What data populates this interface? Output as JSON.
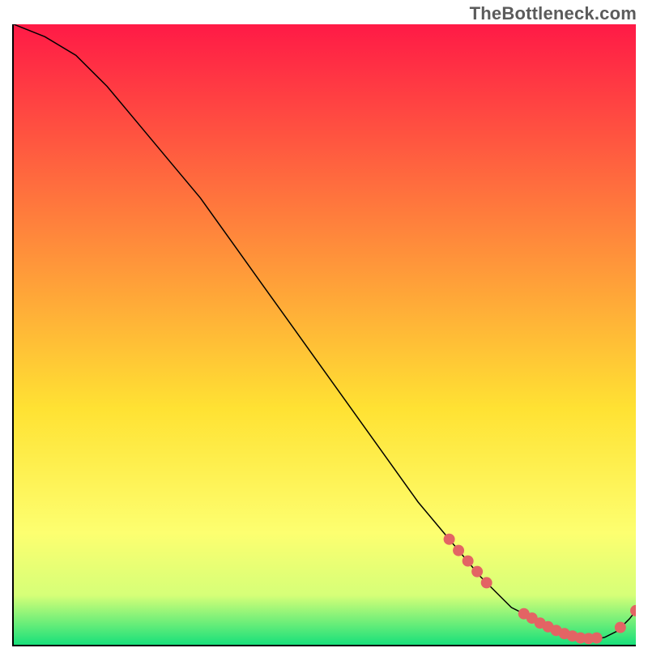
{
  "watermark": "TheBottleneck.com",
  "chart_data": {
    "type": "line",
    "title": "",
    "xlabel": "",
    "ylabel": "",
    "xlim": [
      0,
      100
    ],
    "ylim": [
      0,
      100
    ],
    "background_gradient": {
      "top": "#ff1a46",
      "mid1": "#ff943a",
      "mid2": "#ffe233",
      "mid3": "#fdff70",
      "mid4": "#d6ff78",
      "bottom": "#18e07a"
    },
    "series": [
      {
        "name": "bottleneck-curve",
        "x": [
          0,
          5,
          10,
          15,
          20,
          25,
          30,
          35,
          40,
          45,
          50,
          55,
          60,
          65,
          70,
          75,
          78,
          80,
          82,
          84,
          86,
          88,
          90,
          92,
          94,
          95,
          97,
          99,
          100
        ],
        "y": [
          100,
          98,
          95,
          90,
          84,
          78,
          72,
          65,
          58,
          51,
          44,
          37,
          30,
          23,
          17,
          11,
          8,
          6,
          5,
          3.5,
          2.5,
          1.8,
          1.2,
          1,
          1,
          1.2,
          2.2,
          4.2,
          5.5
        ],
        "color": "#000000"
      }
    ],
    "markers": {
      "name": "highlight-points",
      "color": "#e36464",
      "radius": 7,
      "points_xy": [
        [
          70,
          17
        ],
        [
          71.5,
          15.2
        ],
        [
          73,
          13.5
        ],
        [
          74.5,
          11.8
        ],
        [
          76,
          10
        ],
        [
          82,
          5
        ],
        [
          83.3,
          4.3
        ],
        [
          84.6,
          3.5
        ],
        [
          85.9,
          2.9
        ],
        [
          87.2,
          2.3
        ],
        [
          88.5,
          1.8
        ],
        [
          89.8,
          1.4
        ],
        [
          91.1,
          1.1
        ],
        [
          92.4,
          1.0
        ],
        [
          93.7,
          1.1
        ],
        [
          97.5,
          2.8
        ],
        [
          100,
          5.5
        ]
      ]
    }
  }
}
